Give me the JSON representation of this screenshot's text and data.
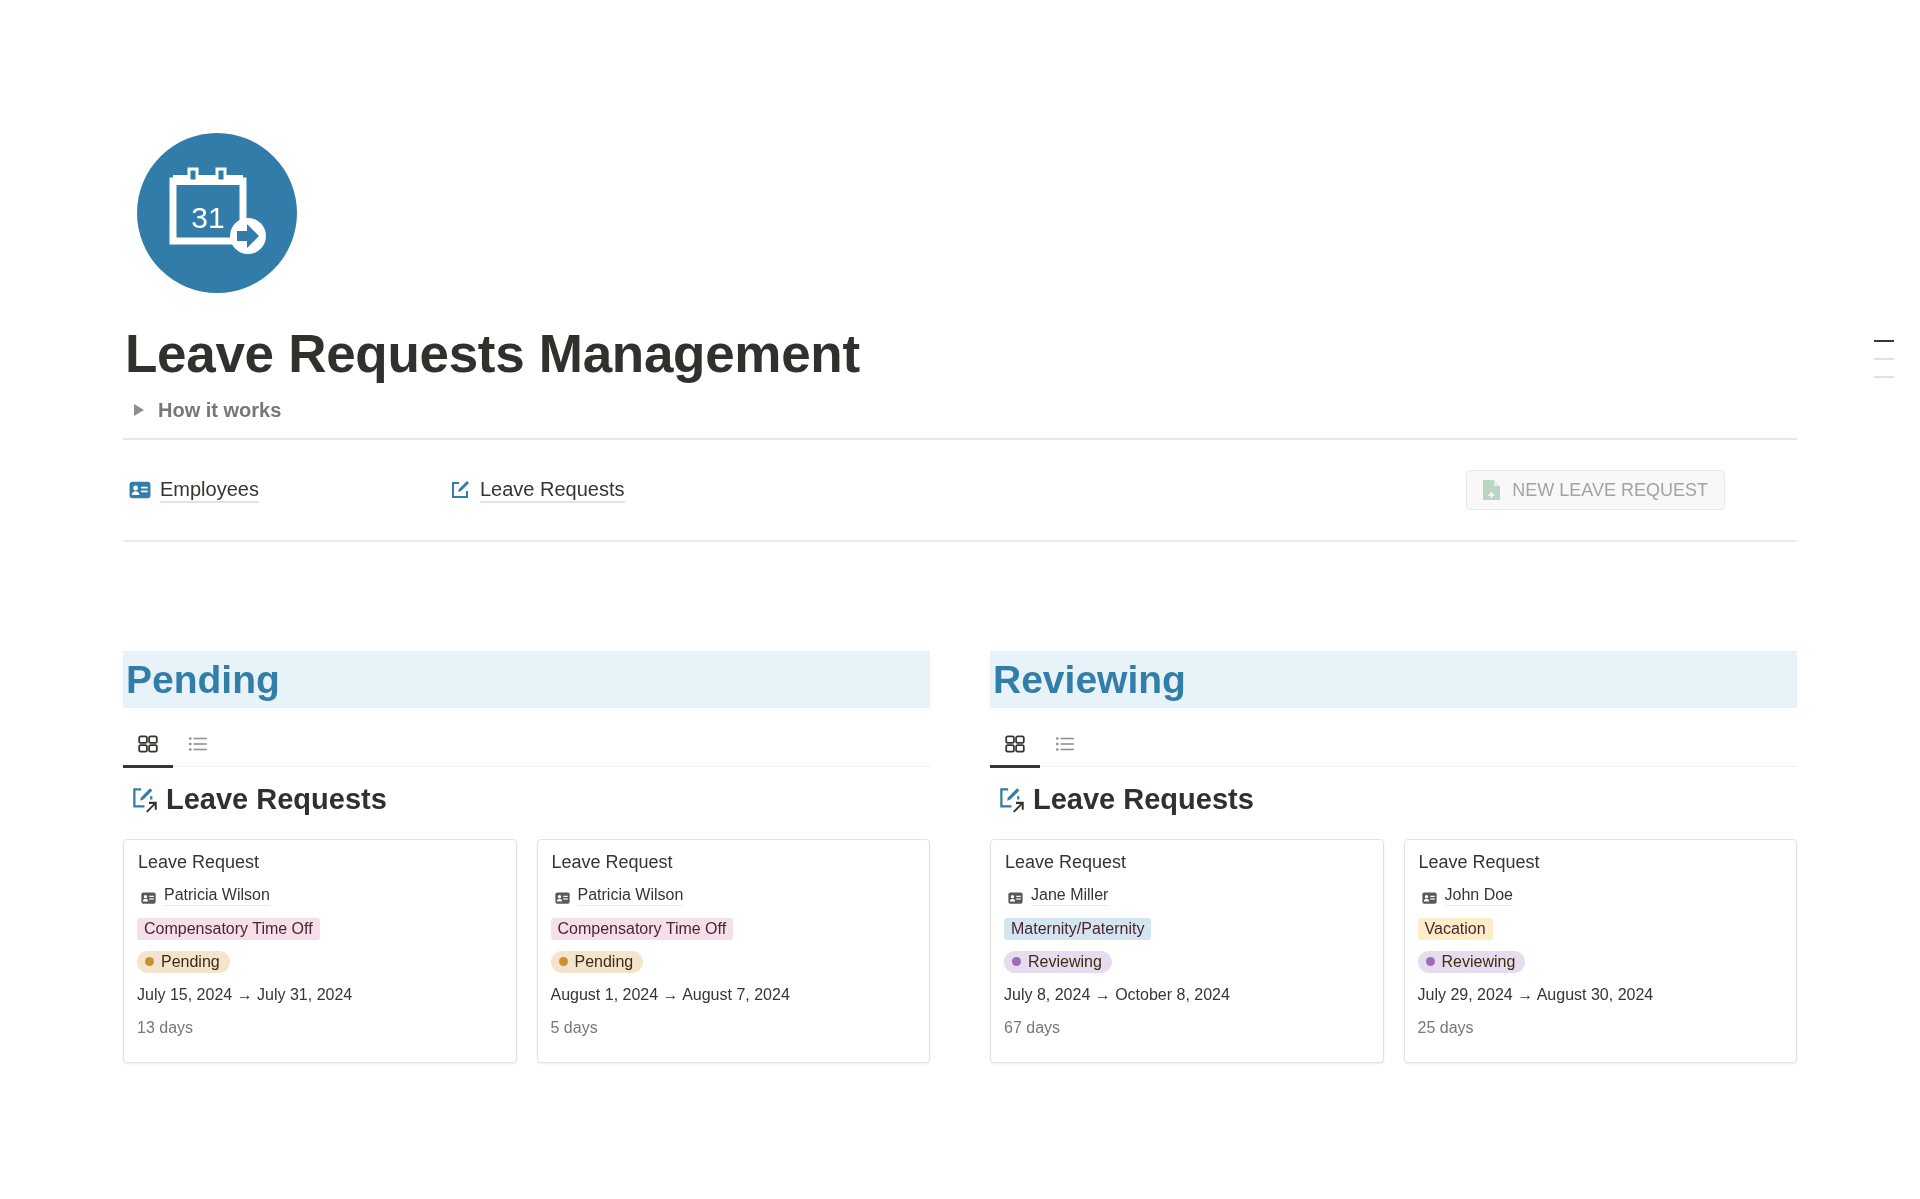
{
  "page": {
    "icon_label": "31",
    "title": "Leave Requests Management",
    "toggle": {
      "label": "How it works",
      "expanded": false
    }
  },
  "links": [
    {
      "kind": "employees",
      "label": "Employees"
    },
    {
      "kind": "requests",
      "label": "Leave Requests"
    }
  ],
  "new_button": {
    "label": "NEW LEAVE REQUEST"
  },
  "sections": [
    {
      "title": "Pending",
      "views": [
        {
          "kind": "gallery",
          "selected": true
        },
        {
          "kind": "list",
          "selected": false
        }
      ],
      "database_title": "Leave Requests",
      "cards": [
        {
          "title": "Leave Request",
          "employee": "Patricia Wilson",
          "type": {
            "label": "Compensatory Time Off",
            "color": "#f5e0e9"
          },
          "status": {
            "label": "Pending",
            "color": "#cb912f"
          },
          "dates": "July 15, 2024 → July 31, 2024",
          "duration": "13 days"
        },
        {
          "title": "Leave Request",
          "employee": "Patricia Wilson",
          "type": {
            "label": "Compensatory Time Off",
            "color": "#f5e0e9"
          },
          "status": {
            "label": "Pending",
            "color": "#cb912f"
          },
          "dates": "August 1, 2024 → August 7, 2024",
          "duration": "5 days"
        }
      ]
    },
    {
      "title": "Reviewing",
      "views": [
        {
          "kind": "gallery",
          "selected": true
        },
        {
          "kind": "list",
          "selected": false
        }
      ],
      "database_title": "Leave Requests",
      "cards": [
        {
          "title": "Leave Request",
          "employee": "Jane Miller",
          "type": {
            "label": "Maternity/Paternity",
            "color": "#d3e5ef"
          },
          "status": {
            "label": "Reviewing",
            "color": "#9a6dbb"
          },
          "dates": "July 8, 2024 → October 8, 2024",
          "duration": "67 days"
        },
        {
          "title": "Leave Request",
          "employee": "John Doe",
          "type": {
            "label": "Vacation",
            "color": "#fdecc8"
          },
          "status": {
            "label": "Reviewing",
            "color": "#9a6dbb"
          },
          "dates": "July 29, 2024 → August 30, 2024",
          "duration": "25 days"
        }
      ]
    }
  ]
}
